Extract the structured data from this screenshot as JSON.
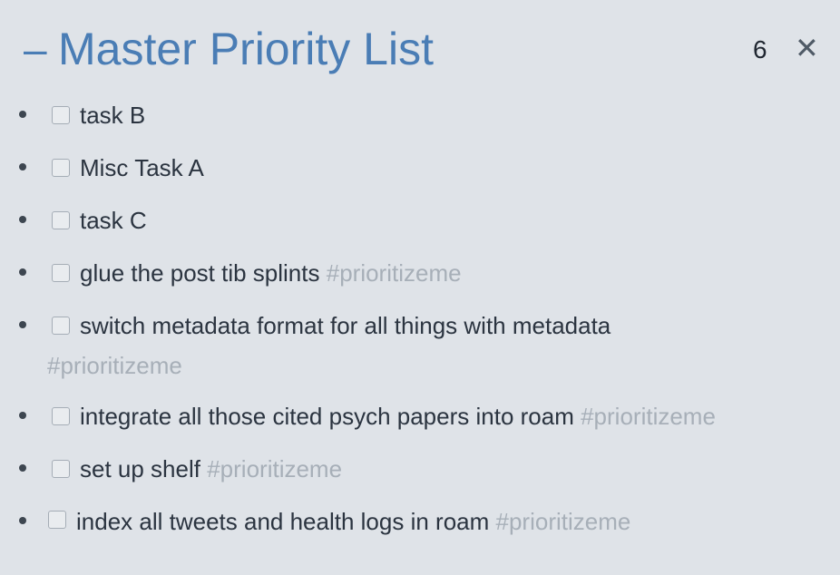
{
  "header": {
    "collapse_symbol": "–",
    "title": "Master Priority List",
    "count": "6",
    "close_symbol": "✕"
  },
  "items": [
    {
      "label": "task B",
      "tag": ""
    },
    {
      "label": "Misc Task A",
      "tag": ""
    },
    {
      "label": "task C",
      "tag": ""
    },
    {
      "label": "glue the post tib splints",
      "tag": "#prioritizeme"
    },
    {
      "label": "switch metadata format for all things with metadata",
      "tag": "#prioritizeme"
    },
    {
      "label": "integrate all those cited psych papers into roam",
      "tag": "#prioritizeme"
    },
    {
      "label": "set up shelf",
      "tag": "#prioritizeme"
    },
    {
      "label": "index all tweets and health logs in roam",
      "tag": "#prioritizeme"
    }
  ],
  "colors": {
    "background": "#dfe3e8",
    "title": "#4a7db5",
    "tag": "#a7afb8",
    "text": "#2b3440"
  }
}
